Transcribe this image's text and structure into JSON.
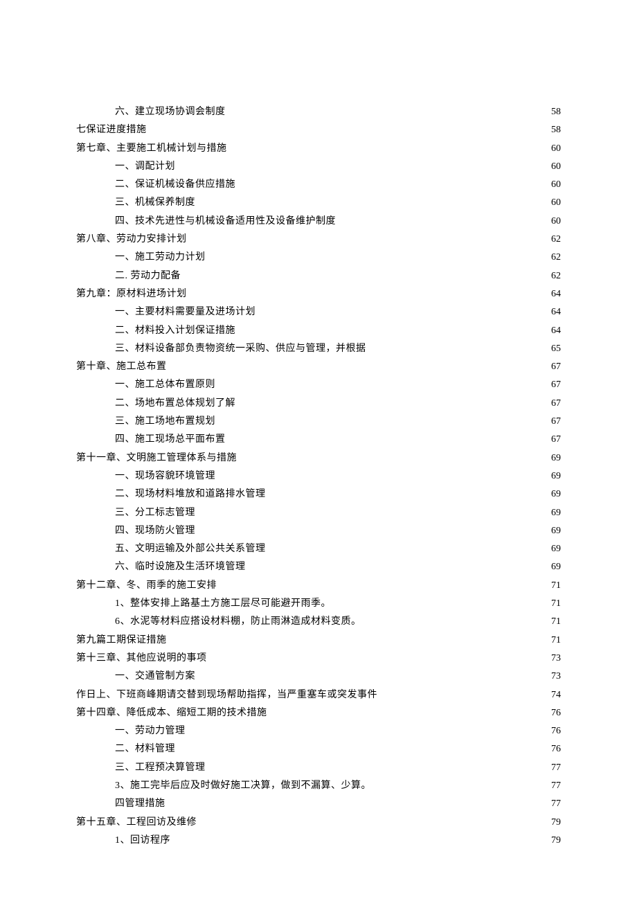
{
  "toc": [
    {
      "level": 1,
      "text": "六、建立现场协调会制度",
      "page": "58"
    },
    {
      "level": 0,
      "text": "七保证进度措施",
      "page": "58"
    },
    {
      "level": 0,
      "text": "第七章、主要施工机械计划与措施",
      "page": "60"
    },
    {
      "level": 1,
      "text": "一、调配计划",
      "page": "60"
    },
    {
      "level": 1,
      "text": "二、保证机械设备供应措施",
      "page": "60"
    },
    {
      "level": 1,
      "text": "三、机械保养制度",
      "page": "60"
    },
    {
      "level": 1,
      "text": "四、技术先进性与机械设备适用性及设备维护制度",
      "page": "60"
    },
    {
      "level": 0,
      "text": "第八章、劳动力安排计划",
      "page": "62"
    },
    {
      "level": 1,
      "text": "一、施工劳动力计划",
      "page": "62"
    },
    {
      "level": 1,
      "text": "二. 劳动力配备",
      "page": "62"
    },
    {
      "level": 0,
      "text": "第九章：原材料进场计划",
      "page": "64"
    },
    {
      "level": 1,
      "text": "一、主要材料需要量及进场计划",
      "page": "64"
    },
    {
      "level": 1,
      "text": "二、材料投入计划保证措施",
      "page": "64"
    },
    {
      "level": 1,
      "text": "三、材料设备部负责物资统一采购、供应与管理，并根据",
      "page": "65"
    },
    {
      "level": 0,
      "text": "第十章、施工总布置",
      "page": "67"
    },
    {
      "level": 1,
      "text": "一、施工总体布置原则",
      "page": "67"
    },
    {
      "level": 1,
      "text": "二、场地布置总体规划了解",
      "page": "67"
    },
    {
      "level": 1,
      "text": "三、施工场地布置规划",
      "page": "67"
    },
    {
      "level": 1,
      "text": "四、施工现场总平面布置",
      "page": "67"
    },
    {
      "level": 0,
      "text": "第十一章、文明施工管理体系与措施",
      "page": "69"
    },
    {
      "level": 1,
      "text": "一、现场容貌环境管理",
      "page": "69"
    },
    {
      "level": 1,
      "text": "二、现场材料堆放和道路排水管理",
      "page": "69"
    },
    {
      "level": 1,
      "text": "三、分工标志管理",
      "page": "69"
    },
    {
      "level": 1,
      "text": "四、现场防火管理",
      "page": "69"
    },
    {
      "level": 1,
      "text": "五、文明运输及外部公共关系管理",
      "page": "69"
    },
    {
      "level": 1,
      "text": "六、临时设施及生活环境管理",
      "page": "69"
    },
    {
      "level": 0,
      "text": "第十二章、冬、雨季的施工安排",
      "page": "71"
    },
    {
      "level": 1,
      "text": "1、整体安排上路基土方施工层尽可能避开雨季。",
      "page": "71"
    },
    {
      "level": 1,
      "text": "6、水泥等材料应搭设材料棚，防止雨淋造成材料变质。",
      "page": "71"
    },
    {
      "level": 0,
      "text": "第九篇工期保证措施",
      "page": "71"
    },
    {
      "level": 0,
      "text": "第十三章、其他应说明的事项",
      "page": "73"
    },
    {
      "level": 1,
      "text": "一、交通管制方案",
      "page": "73"
    },
    {
      "level": 0,
      "text": "作日上、下班商峰期请交替到现场帮助指挥，当严重塞车或突发事件",
      "page": "74"
    },
    {
      "level": 0,
      "text": "第十四章、降低成本、缩短工期的技术措施",
      "page": "76"
    },
    {
      "level": 1,
      "text": "一、劳动力管理",
      "page": "76"
    },
    {
      "level": 1,
      "text": "二、材料管理",
      "page": "76"
    },
    {
      "level": 1,
      "text": "三、工程预决算管理",
      "page": "77"
    },
    {
      "level": 1,
      "text": "3、施工完毕后应及时做好施工决算，做到不漏算、少算。",
      "page": "77"
    },
    {
      "level": 1,
      "text": "四管理措施",
      "page": "77"
    },
    {
      "level": 0,
      "text": "第十五章、工程回访及维修",
      "page": "79"
    },
    {
      "level": 1,
      "text": "1、回访程序",
      "page": "79"
    }
  ]
}
